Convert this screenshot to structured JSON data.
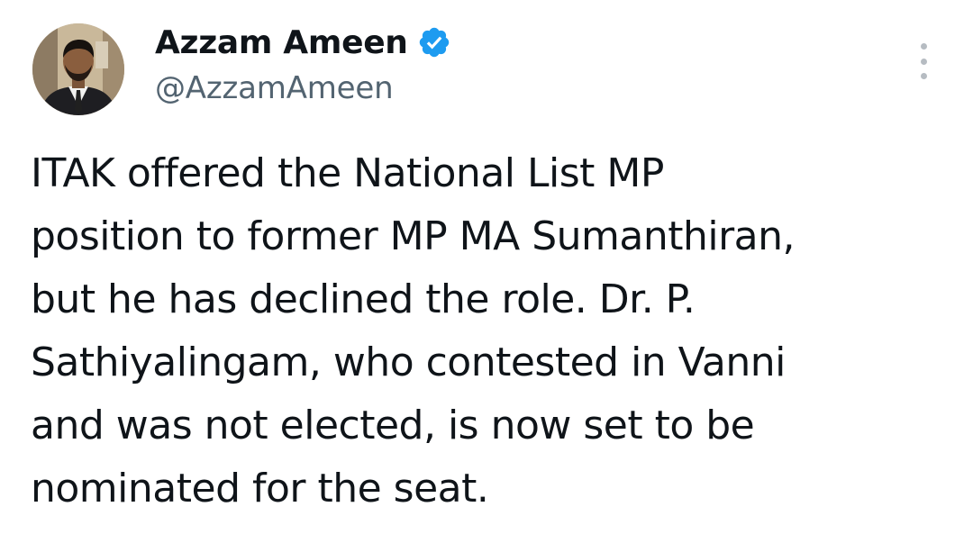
{
  "author": {
    "display_name": "Azzam Ameen",
    "handle": "@AzzamAmeen",
    "verified": true,
    "verified_icon": "verified-badge-icon",
    "verified_color": "#1d9bf0"
  },
  "menu": {
    "icon": "more-options-icon"
  },
  "tweet": {
    "lines": [
      "ITAK offered the National List MP",
      "position to former MP MA Sumanthiran,",
      "but he has declined the role. Dr. P.",
      "Sathiyalingam, who contested in Vanni",
      "and was not elected, is now set to be",
      "nominated for the seat."
    ]
  },
  "colors": {
    "text_primary": "#0f1419",
    "text_secondary": "#536471",
    "accent": "#1d9bf0"
  }
}
